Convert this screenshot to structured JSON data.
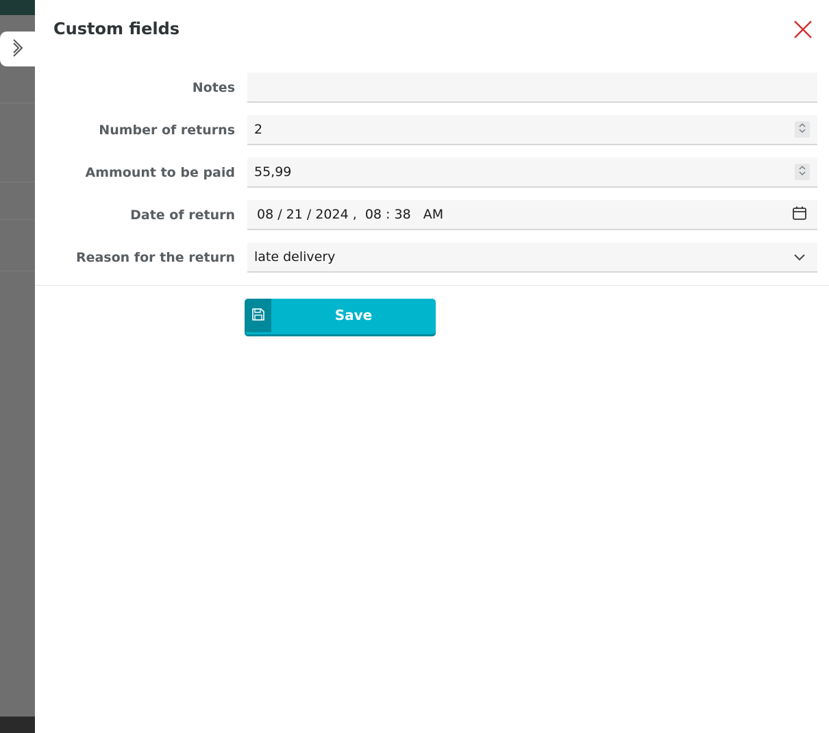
{
  "drawer": {
    "title": "Custom fields"
  },
  "fields": [
    {
      "label": "Notes",
      "value": ""
    },
    {
      "label": "Number of returns",
      "value": "2"
    },
    {
      "label": "Ammount to be paid",
      "value": "55,99"
    },
    {
      "label": "Date of return",
      "value": "08 / 21 / 2024 ,  08 : 38   AM"
    },
    {
      "label": "Reason for the return",
      "value": "late delivery"
    }
  ],
  "actions": {
    "save_label": "Save"
  },
  "icons": {
    "collapse": "chevron-right-icon",
    "close": "close-icon",
    "spinner": "spinner-arrows-icon",
    "calendar": "calendar-icon",
    "dropdown": "chevron-down-icon",
    "save": "floppy-disk-icon"
  },
  "colors": {
    "accent": "#00b5cc",
    "accent_dark": "#00899b",
    "close": "#d32f2f"
  }
}
